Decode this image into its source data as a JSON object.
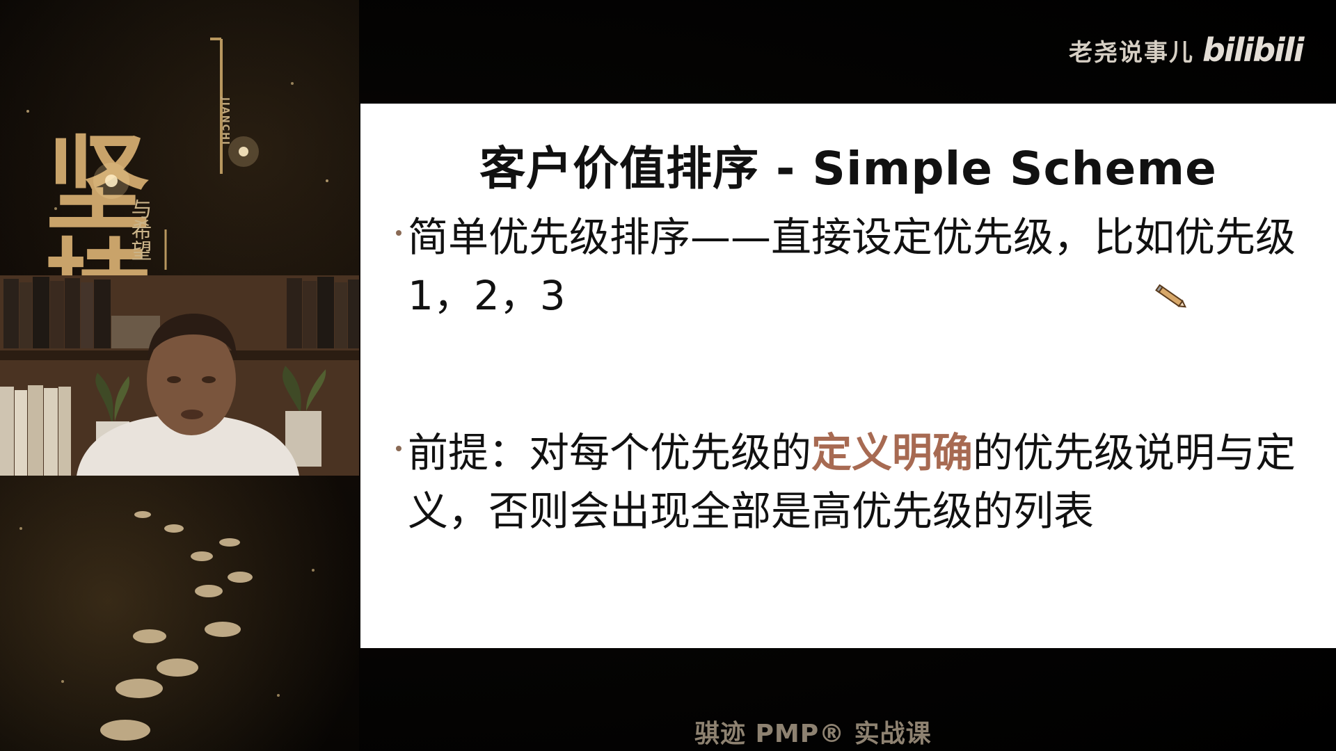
{
  "poster": {
    "main_title": "坚持",
    "pinyin": "JIANCHI",
    "subtitle": "与希望"
  },
  "watermark": {
    "channel_name": "老尧说事儿",
    "platform_logo": "bilibili"
  },
  "slide": {
    "title": "客户价值排序 - Simple Scheme",
    "bullets": [
      {
        "text": "简单优先级排序——直接设定优先级，比如优先级1，2，3"
      },
      {
        "text_before": "前提：对每个优先级的",
        "highlight": "定义明确",
        "text_after": "的优先级说明与定义，否则会出现全部是高优先级的列表"
      }
    ]
  },
  "footer": {
    "course_caption": "骐迹 PMP® 实战课"
  },
  "colors": {
    "slide_background": "#ffffff",
    "slide_text": "#111111",
    "highlight": "#a76a52",
    "poster_gold": "#c9a36a",
    "background": "#000000"
  },
  "icons": {
    "cursor": "pen-cursor-icon",
    "footprints": "footprints-icon",
    "sparkles": "sparkle-icon"
  }
}
